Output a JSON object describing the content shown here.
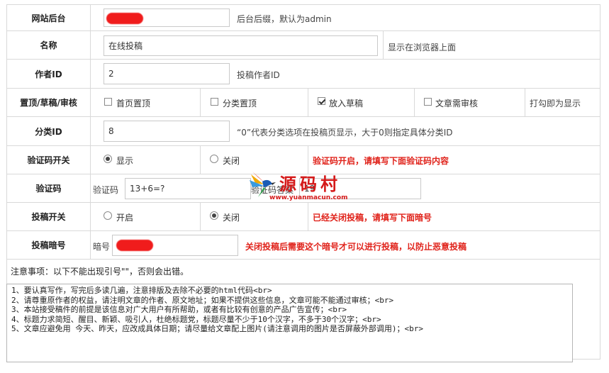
{
  "rows": [
    {
      "label": "网站后台",
      "value": "",
      "hint": "后台后缀，默认为admin"
    },
    {
      "label": "名称",
      "value": "在线投稿",
      "hint": "显示在浏览器上面"
    },
    {
      "label": "作者ID",
      "value": "2",
      "hint": "投稿作者ID"
    },
    {
      "label": "置顶/草稿/审核",
      "options": [
        {
          "label": "首页置顶",
          "checked": false
        },
        {
          "label": "分类置顶",
          "checked": false
        },
        {
          "label": "放入草稿",
          "checked": true
        },
        {
          "label": "文章需审核",
          "checked": false
        }
      ],
      "hint": "打勾即为显示"
    },
    {
      "label": "分类ID",
      "value": "8",
      "hint": "“0”代表分类选项在投稿页显示，大于0则指定具体分类ID"
    },
    {
      "label": "验证码开关",
      "options": [
        {
          "label": "显示",
          "selected": true
        },
        {
          "label": "关闭",
          "selected": false
        }
      ],
      "hint": "验证码开启，请填写下面验证码内容"
    },
    {
      "label": "验证码",
      "question_label": "验证码",
      "question_value": "13+6=?",
      "answer_label": "验证码答案",
      "answer_value": "19"
    },
    {
      "label": "投稿开关",
      "options": [
        {
          "label": "开启",
          "selected": false
        },
        {
          "label": "关闭",
          "selected": true
        }
      ],
      "hint": "已经关闭投稿，请填写下面暗号"
    },
    {
      "label": "投稿暗号",
      "field_label": "暗号",
      "value": "",
      "hint": "关闭投稿后需要这个暗号才可以进行投稿，以防止恶意投稿"
    }
  ],
  "notice": {
    "title": "注意事项：以下不能出现引号\"\"，否则会出错。",
    "text": "1、要认真写作，写完后多读几遍，注意排版及去除不必要的html代码<br>\n2、请尊重原作者的权益，请注明文章的作者、原文地址；如果不提供这些信息，文章可能不能通过审核；<br>\n3、本站接受稿件的前提是该信息对广大用户有所帮助，或者有比较有创意的产品广告宣传；<br>\n4、标题力求简短、醒目、新颖、吸引人，杜绝标题党，标题尽量不少于10个汉字，不多于30个汉字；<br>\n5、文章应避免用 今天、昨天，应改成具体日期；请尽量给文章配上图片(请注意调用的图片是否屏蔽外部调用)；<br>"
  },
  "watermark": {
    "text": "源码村",
    "url": "www.yuanmacun.com"
  },
  "colors": {
    "border": "#d9d9d9",
    "alert": "#e0231b"
  }
}
